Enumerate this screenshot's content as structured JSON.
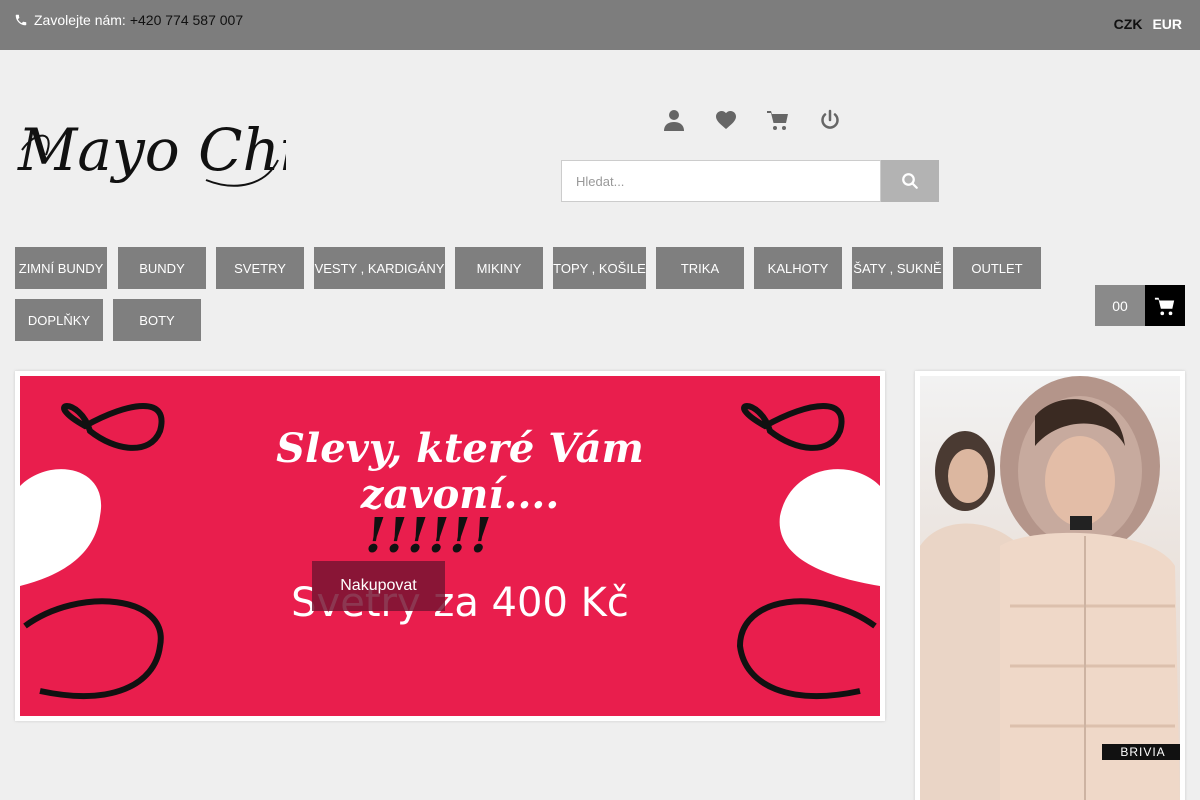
{
  "topbar": {
    "phone_label": "Zavolejte nám:",
    "phone_number": "+420 774 587 007",
    "currencies": [
      "CZK",
      "EUR"
    ],
    "active_currency": "CZK"
  },
  "header": {
    "logo_text": "Mayo Chix",
    "icons": [
      "user-icon",
      "heart-icon",
      "cart-icon",
      "power-icon"
    ]
  },
  "search": {
    "placeholder": "Hledat..."
  },
  "nav": {
    "items": [
      "ZIMNÍ BUNDY",
      "BUNDY",
      "SVETRY",
      "VESTY , KARDIGÁNY",
      "MIKINY",
      "TOPY , KOŠILE",
      "TRIKA",
      "KALHOTY",
      "ŠATY , SUKNĚ",
      "OUTLET",
      "DOPLŇKY",
      "BOTY"
    ]
  },
  "cart": {
    "count": "00"
  },
  "slider": {
    "headline": "Slevy, které Vám zavoní....",
    "exclaim": "!!!!!!",
    "subline": "Svetry za 400 Kč",
    "cta_label": "Nakupovat",
    "bg_color": "#e91e4d"
  },
  "promo": {
    "brand": "BRIVIA"
  }
}
